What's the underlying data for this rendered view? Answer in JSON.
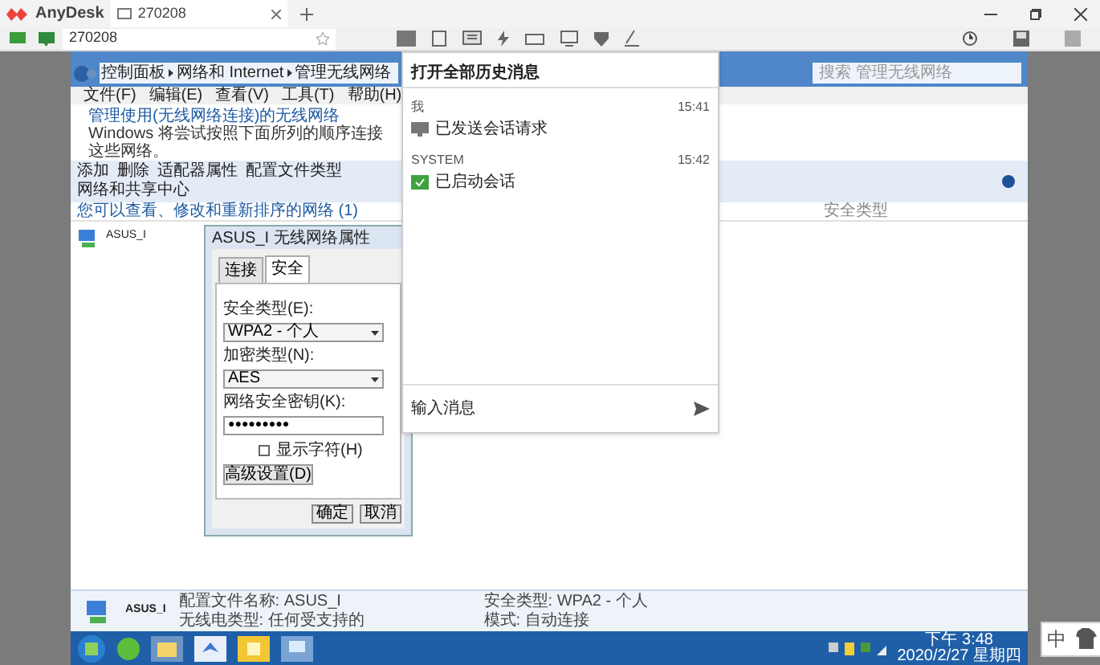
{
  "app": {
    "name": "AnyDesk",
    "tab": {
      "label": "270208",
      "selected": true
    },
    "address": "270208"
  },
  "remote": {
    "explorer": {
      "breadcrumb": [
        "控制面板",
        "网络和 Internet",
        "管理无线网络"
      ],
      "search_placeholder": "搜索 管理无线网络",
      "menu": [
        "文件(F)",
        "编辑(E)",
        "查看(V)",
        "工具(T)",
        "帮助(H)"
      ],
      "heading": "管理使用(无线网络连接)的无线网络",
      "description": "Windows 将尝试按照下面所列的顺序连接这些网络。",
      "toolbar": [
        "添加",
        "删除",
        "适配器属性",
        "配置文件类型",
        "网络和共享中心"
      ],
      "group_label": "您可以查看、修改和重新排序的网络 (1)",
      "network": "ASUS_I",
      "column_3": "安全类型"
    },
    "dialog": {
      "title": "ASUS_I 无线网络属性",
      "tabs": [
        {
          "label": "连接",
          "selected": false
        },
        {
          "label": "安全",
          "selected": true
        }
      ],
      "fields": [
        {
          "label": "安全类型(E):",
          "value": "WPA2 - 个人",
          "kind": "dropdown"
        },
        {
          "label": "加密类型(N):",
          "value": "AES",
          "kind": "dropdown"
        },
        {
          "label": "网络安全密钥(K):",
          "value": "●●●●●●●●●",
          "kind": "password"
        }
      ],
      "show_chars": {
        "label": "显示字符(H)",
        "checked": false
      },
      "advanced": "高级设置(D)",
      "buttons": [
        "确定",
        "取消"
      ]
    },
    "details": {
      "name": "ASUS_I",
      "lines": [
        "配置文件名称: ASUS_I",
        "安全类型: WPA2 - 个人",
        "无线电类型: 任何受支持的",
        "模式: 自动连接"
      ]
    },
    "clock": {
      "time": "下午 3:48",
      "date": "2020/2/27 星期四"
    }
  },
  "chat": {
    "header": "打开全部历史消息",
    "messages": [
      {
        "sender": "我",
        "time": "15:41",
        "text": "已发送会话请求",
        "kind": "request"
      },
      {
        "sender": "SYSTEM",
        "time": "15:42",
        "text": "已启动会话",
        "kind": "started"
      }
    ],
    "placeholder": "输入消息"
  },
  "ime": {
    "label": "中"
  }
}
